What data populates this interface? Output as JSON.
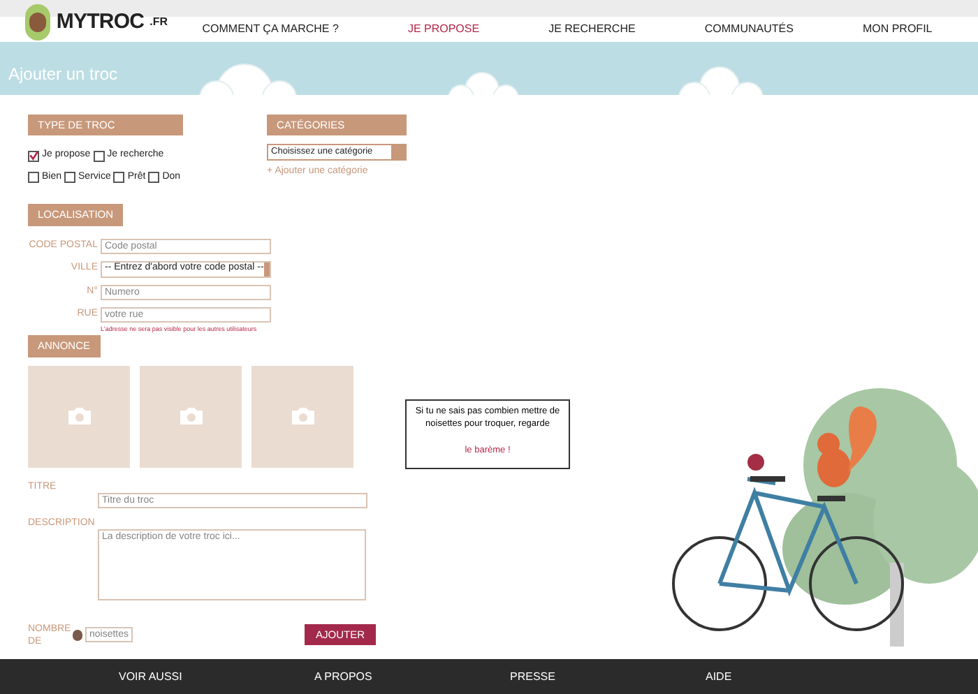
{
  "logo": {
    "text": "MYTROC",
    "suffix": ".FR"
  },
  "nav": [
    {
      "label": "COMMENT ÇA MARCHE ?",
      "selected": false
    },
    {
      "label": "JE PROPOSE",
      "selected": true
    },
    {
      "label": "JE RECHERCHE",
      "selected": false
    },
    {
      "label": "COMMUNAUTÉS",
      "selected": false
    },
    {
      "label": "MON PROFIL",
      "selected": false
    }
  ],
  "banner": {
    "title": "Ajouter un troc"
  },
  "type_section": {
    "heading": "TYPE DE TROC",
    "modes": [
      {
        "label": "Je propose",
        "checked": true
      },
      {
        "label": "Je recherche",
        "checked": false
      }
    ],
    "kinds": [
      {
        "label": "Bien",
        "checked": false
      },
      {
        "label": "Service",
        "checked": false
      },
      {
        "label": "Prêt",
        "checked": false
      },
      {
        "label": "Don",
        "checked": false
      }
    ]
  },
  "categories": {
    "heading": "CATÉGORIES",
    "select": "Choisissez une catégorie",
    "add_link": "+ Ajouter une catégorie"
  },
  "location": {
    "heading": "LOCALISATION",
    "fields": [
      {
        "kind": "input",
        "label": "CODE POSTAL",
        "placeholder": "Code postal"
      },
      {
        "kind": "select",
        "label": "VILLE",
        "value": "-- Entrez d'abord votre code postal --"
      },
      {
        "kind": "input",
        "label": "N°",
        "placeholder": "Numero"
      },
      {
        "kind": "input",
        "label": "RUE",
        "placeholder": "votre rue"
      }
    ],
    "note": "L'adresse ne sera pas visible pour les autres utilisateurs"
  },
  "ad": {
    "heading": "ANNONCE",
    "photos": [
      {
        "kind": "empty"
      },
      {
        "kind": "empty"
      },
      {
        "kind": "empty"
      }
    ],
    "title_label": "TITRE",
    "title_placeholder": "Titre du troc",
    "description_label": "DESCRIPTION",
    "description_placeholder": "La description de votre troc ici...",
    "count_label": "NOMBRE DE",
    "count_placeholder": "noisettes",
    "submit": "AJOUTER"
  },
  "bubble": {
    "text": "Si tu ne sais pas combien mettre de noisettes pour troquer, regarde",
    "link": "le barème !"
  },
  "footer": [
    "VOIR AUSSI",
    "A PROPOS",
    "PRESSE",
    "AIDE"
  ]
}
